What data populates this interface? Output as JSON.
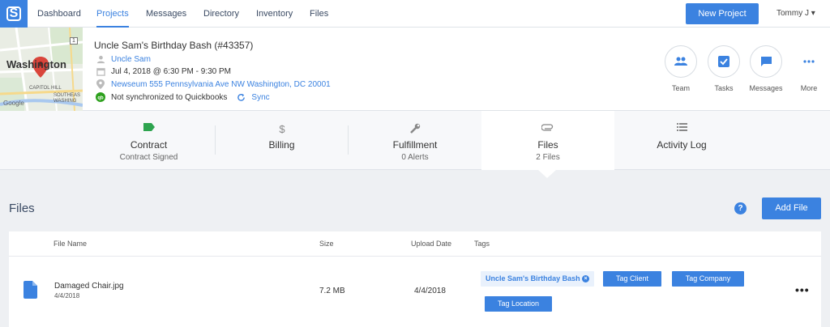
{
  "nav": {
    "logo": "S",
    "items": [
      "Dashboard",
      "Projects",
      "Messages",
      "Directory",
      "Inventory",
      "Files"
    ],
    "active": "Projects",
    "new_project": "New Project",
    "user": "Tommy J ▾"
  },
  "project": {
    "title": "Uncle Sam's Birthday Bash (#43357)",
    "client": "Uncle Sam",
    "datetime": "Jul 4, 2018 @ 6:30 PM - 9:30 PM",
    "location": "Newseum 555 Pennsylvania Ave NW Washington, DC 20001",
    "qb_status": "Not synchronized to Quickbooks",
    "sync": "Sync",
    "map_labels": {
      "city": "Washington",
      "district": "CAPITOL HILL",
      "area": "SOUTHEAS WASHING",
      "road": "1",
      "brand": "Google"
    }
  },
  "actions": [
    {
      "label": "Team",
      "icon": "team-icon"
    },
    {
      "label": "Tasks",
      "icon": "tasks-icon"
    },
    {
      "label": "Messages",
      "icon": "messages-icon"
    },
    {
      "label": "More",
      "icon": "more-icon"
    }
  ],
  "tabs": [
    {
      "title": "Contract",
      "sub": "Contract Signed",
      "icon": "tag-icon"
    },
    {
      "title": "Billing",
      "sub": "",
      "icon": "dollar-icon"
    },
    {
      "title": "Fulfillment",
      "sub": "0 Alerts",
      "icon": "wrench-icon"
    },
    {
      "title": "Files",
      "sub": "2 Files",
      "icon": "paperclip-icon"
    },
    {
      "title": "Activity Log",
      "sub": "",
      "icon": "list-icon"
    }
  ],
  "files": {
    "title": "Files",
    "help": "?",
    "add_file": "Add File",
    "columns": [
      "File Name",
      "Size",
      "Upload Date",
      "Tags"
    ],
    "rows": [
      {
        "name": "Damaged Chair.jpg",
        "date": "4/4/2018",
        "size": "7.2 MB",
        "upload_date": "4/4/2018",
        "tag": "Uncle Sam's Birthday Bash",
        "tag_remove": "×",
        "tag_buttons": [
          "Tag Client",
          "Tag Company",
          "Tag Location"
        ],
        "more": "•••"
      }
    ]
  },
  "colors": {
    "accent": "#3b82e0",
    "qb_green": "#2ca01c"
  }
}
